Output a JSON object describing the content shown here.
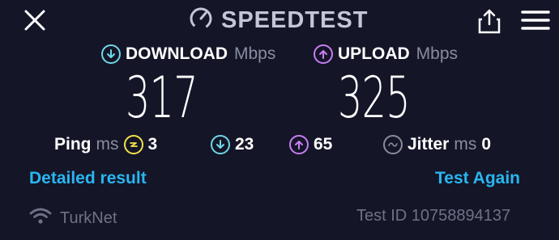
{
  "header": {
    "title": "SPEEDTEST",
    "close_icon": "close-icon",
    "share_icon": "share-icon",
    "menu_icon": "hamburger-menu-icon"
  },
  "download": {
    "label": "DOWNLOAD",
    "unit": "Mbps",
    "value": "317",
    "color": "#6fd8e8"
  },
  "upload": {
    "label": "UPLOAD",
    "unit": "Mbps",
    "value": "325",
    "color": "#c97ef5"
  },
  "ping": {
    "label": "Ping",
    "unit": "ms",
    "value": "3",
    "color": "#f2e24a"
  },
  "ping_download": {
    "value": "23"
  },
  "ping_upload": {
    "value": "65"
  },
  "jitter": {
    "label": "Jitter",
    "unit": "ms",
    "value": "0"
  },
  "actions": {
    "detailed": "Detailed result",
    "again": "Test Again",
    "link_color": "#29b6f0"
  },
  "footer": {
    "isp": "TurkNet",
    "test_id": "Test ID 10758894137"
  }
}
